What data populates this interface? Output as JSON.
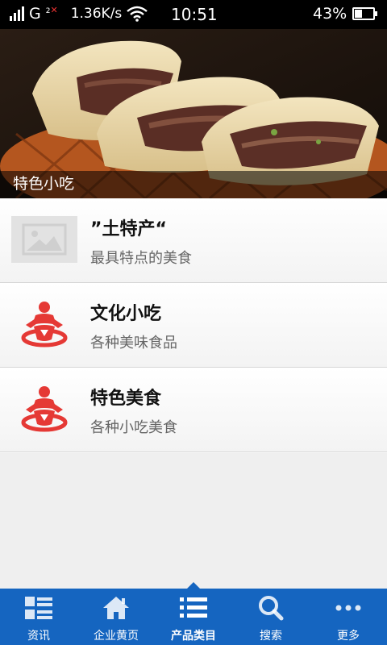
{
  "status_bar": {
    "network_type": "G",
    "sim2_label": "2",
    "speed": "1.36K/s",
    "time": "10:51",
    "battery_percent": "43%",
    "battery_level": 0.43
  },
  "banner": {
    "caption": "特色小吃"
  },
  "list": {
    "items": [
      {
        "title": "”土特产“",
        "desc": "最具特点的美食",
        "icon": "image-placeholder-icon"
      },
      {
        "title": "文化小吃",
        "desc": "各种美味食品",
        "icon": "baby-figure-icon"
      },
      {
        "title": "特色美食",
        "desc": "各种小吃美食",
        "icon": "baby-figure-icon"
      }
    ]
  },
  "tab_bar": {
    "active_index": 2,
    "tabs": [
      {
        "label": "资讯",
        "icon": "news-grid-icon"
      },
      {
        "label": "企业黄页",
        "icon": "home-icon"
      },
      {
        "label": "产品类目",
        "icon": "list-icon"
      },
      {
        "label": "搜索",
        "icon": "search-icon"
      },
      {
        "label": "更多",
        "icon": "more-dots-icon"
      }
    ]
  },
  "colors": {
    "tab_bar_bg": "#1565c0",
    "icon_red": "#e53935"
  }
}
